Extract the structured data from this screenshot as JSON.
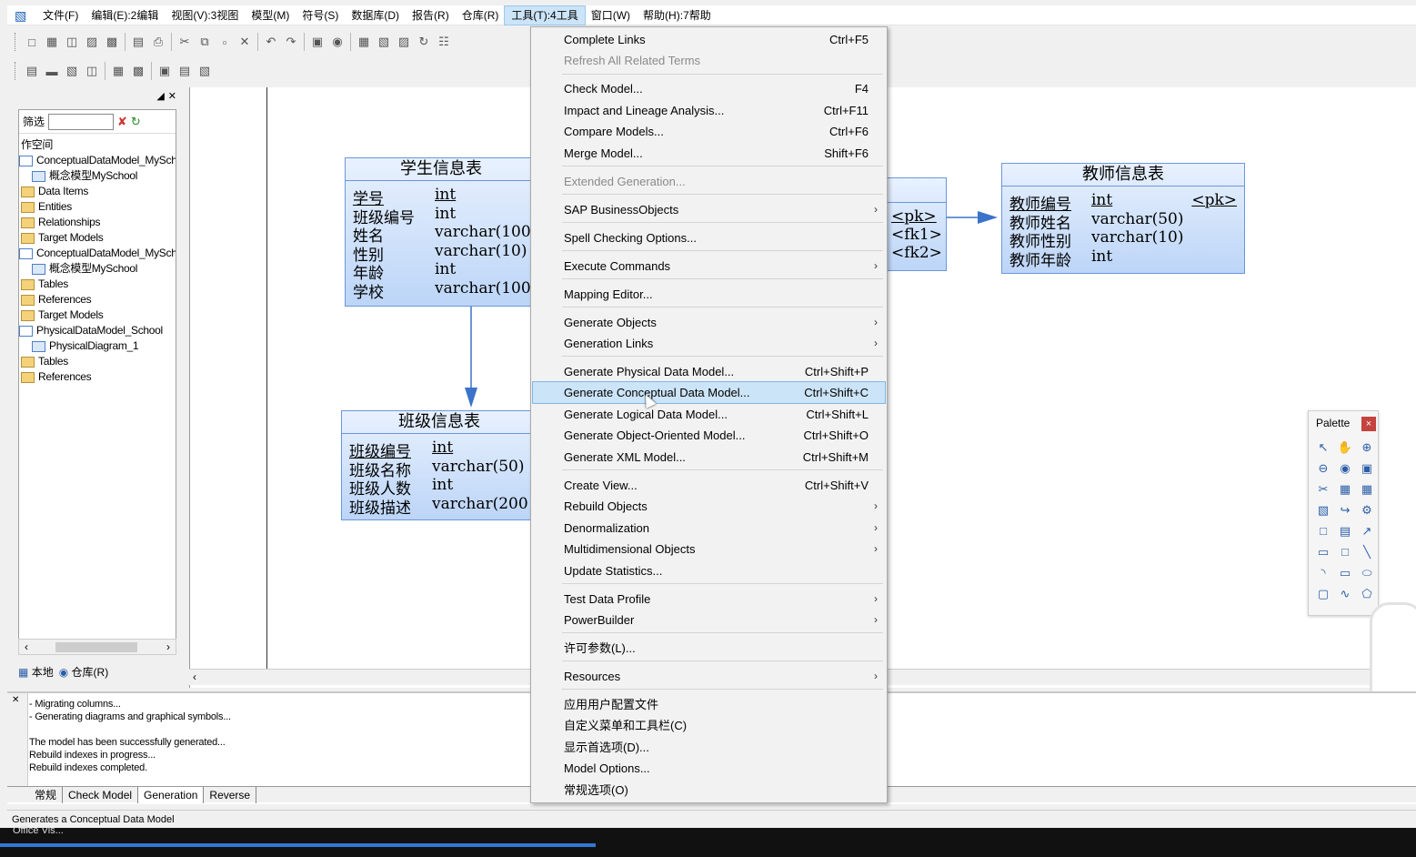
{
  "menubar": {
    "items": [
      "文件(F)",
      "编辑(E):2编辑",
      "视图(V):3视图",
      "模型(M)",
      "符号(S)",
      "数据库(D)",
      "报告(R)",
      "仓库(R)",
      "工具(T):4工具",
      "窗口(W)",
      "帮助(H):7帮助"
    ]
  },
  "browser": {
    "filter_label": "筛选",
    "tree": [
      {
        "label": "作空间",
        "icon": "workspace"
      },
      {
        "label": "ConceptualDataModel_MySch",
        "icon": "model"
      },
      {
        "label": "概念模型MySchool",
        "icon": "diagram"
      },
      {
        "label": "Data Items",
        "icon": "folder"
      },
      {
        "label": "Entities",
        "icon": "folder"
      },
      {
        "label": "Relationships",
        "icon": "folder"
      },
      {
        "label": "Target Models",
        "icon": "folder"
      },
      {
        "label": "ConceptualDataModel_MySch",
        "icon": "model"
      },
      {
        "label": "概念模型MySchool",
        "icon": "diagram"
      },
      {
        "label": "Tables",
        "icon": "folder"
      },
      {
        "label": "References",
        "icon": "folder"
      },
      {
        "label": "Target Models",
        "icon": "folder"
      },
      {
        "label": "PhysicalDataModel_School",
        "icon": "model"
      },
      {
        "label": "PhysicalDiagram_1",
        "icon": "diagram"
      },
      {
        "label": "Tables",
        "icon": "folder"
      },
      {
        "label": "References",
        "icon": "folder"
      }
    ],
    "tabs": {
      "local": "本地",
      "repo": "仓库(R)"
    }
  },
  "diagram": {
    "student": {
      "title": "学生信息表",
      "rows": [
        {
          "name": "学号",
          "type": "int"
        },
        {
          "name": "班级编号",
          "type": "int"
        },
        {
          "name": "姓名",
          "type": "varchar(100"
        },
        {
          "name": "性别",
          "type": "varchar(10)"
        },
        {
          "name": "年龄",
          "type": "int"
        },
        {
          "name": "学校",
          "type": "varchar(100"
        }
      ]
    },
    "class": {
      "title": "班级信息表",
      "rows": [
        {
          "name": "班级编号",
          "type": "int"
        },
        {
          "name": "班级名称",
          "type": "varchar(50)"
        },
        {
          "name": "班级人数",
          "type": "int"
        },
        {
          "name": "班级描述",
          "type": "varchar(200"
        }
      ]
    },
    "partial": {
      "keys": [
        "<pk>",
        "<fk1>",
        "<fk2>"
      ]
    },
    "teacher": {
      "title": "教师信息表",
      "rows": [
        {
          "name": "教师编号",
          "type": "int",
          "key": "<pk>"
        },
        {
          "name": "教师姓名",
          "type": "varchar(50)",
          "key": ""
        },
        {
          "name": "教师性别",
          "type": "varchar(10)",
          "key": ""
        },
        {
          "name": "教师年龄",
          "type": "int",
          "key": ""
        }
      ]
    }
  },
  "palette": {
    "title": "Palette",
    "close": "×"
  },
  "menu": {
    "items": [
      {
        "label": "Complete Links",
        "shortcut": "Ctrl+F5"
      },
      {
        "label": "Refresh All Related Terms",
        "shortcut": "",
        "disabled": true
      },
      {
        "label": "Check Model...",
        "shortcut": "F4"
      },
      {
        "label": "Impact and Lineage Analysis...",
        "shortcut": "Ctrl+F11"
      },
      {
        "label": "Compare Models...",
        "shortcut": "Ctrl+F6"
      },
      {
        "label": "Merge Model...",
        "shortcut": "Shift+F6"
      },
      {
        "label": "Extended Generation...",
        "shortcut": "",
        "disabled": true
      },
      {
        "label": "SAP BusinessObjects",
        "submenu": true
      },
      {
        "label": "Spell Checking Options..."
      },
      {
        "label": "Execute Commands",
        "submenu": true
      },
      {
        "label": "Mapping Editor..."
      },
      {
        "label": "Generate Objects",
        "submenu": true
      },
      {
        "label": "Generation Links",
        "submenu": true
      },
      {
        "label": "Generate Physical Data Model...",
        "shortcut": "Ctrl+Shift+P"
      },
      {
        "label": "Generate Conceptual Data Model...",
        "shortcut": "Ctrl+Shift+C",
        "highlighted": true
      },
      {
        "label": "Generate Logical Data Model...",
        "shortcut": "Ctrl+Shift+L"
      },
      {
        "label": "Generate Object-Oriented Model...",
        "shortcut": "Ctrl+Shift+O"
      },
      {
        "label": "Generate XML Model...",
        "shortcut": "Ctrl+Shift+M"
      },
      {
        "label": "Create View...",
        "shortcut": "Ctrl+Shift+V"
      },
      {
        "label": "Rebuild Objects",
        "submenu": true
      },
      {
        "label": "Denormalization",
        "submenu": true
      },
      {
        "label": "Multidimensional Objects",
        "submenu": true
      },
      {
        "label": "Update Statistics..."
      },
      {
        "label": "Test Data Profile",
        "submenu": true
      },
      {
        "label": "PowerBuilder",
        "submenu": true
      },
      {
        "label": "许可参数(L)..."
      },
      {
        "label": "Resources",
        "submenu": true
      },
      {
        "label": "应用用户配置文件"
      },
      {
        "label": "自定义菜单和工具栏(C)"
      },
      {
        "label": "显示首选项(D)..."
      },
      {
        "label": "Model Options..."
      },
      {
        "label": "常规选项(O)"
      }
    ]
  },
  "output": {
    "lines": [
      " - Migrating columns...",
      " - Generating diagrams and graphical symbols...",
      "",
      "The model has been successfully generated...",
      "Rebuild indexes in progress...",
      "Rebuild indexes completed."
    ],
    "tabs": [
      "常规",
      "Check Model",
      "Generation",
      "Reverse"
    ]
  },
  "status": "Generates a Conceptual Data Model",
  "taskbar_text": "Office Vis..."
}
